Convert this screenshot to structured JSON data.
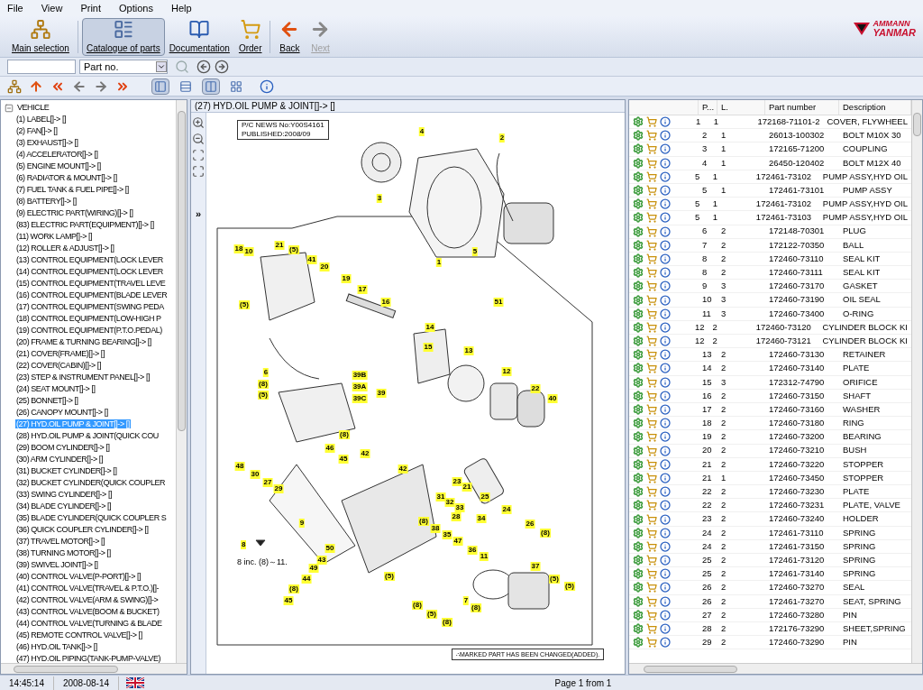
{
  "menu": [
    "File",
    "View",
    "Print",
    "Options",
    "Help"
  ],
  "toolbar": [
    {
      "kind": "main",
      "label": "Main selection",
      "selected": false,
      "disabled": false
    },
    {
      "kind": "catalogue",
      "label": "Catalogue of parts",
      "selected": true,
      "disabled": false
    },
    {
      "kind": "docs",
      "label": "Documentation",
      "selected": false,
      "disabled": false
    },
    {
      "kind": "order",
      "label": "Order",
      "selected": false,
      "disabled": false
    },
    {
      "kind": "back",
      "label": "Back",
      "selected": false,
      "disabled": false
    },
    {
      "kind": "next",
      "label": "Next",
      "selected": false,
      "disabled": true
    }
  ],
  "logo": {
    "line1": "AMMANN",
    "line2": "YANMAR"
  },
  "search": {
    "field": "Part no."
  },
  "view_buttons": [
    {
      "selected": true
    },
    {
      "selected": false
    },
    {
      "selected": true
    },
    {
      "selected": false
    }
  ],
  "tree": {
    "label": "VEHICLE",
    "expanded": true,
    "children": [
      {
        "label": "(1) LABEL[]-> []",
        "selected": false
      },
      {
        "label": "(2) FAN[]-> []",
        "selected": false
      },
      {
        "label": "(3) EXHAUST[]-> []",
        "selected": false
      },
      {
        "label": "(4) ACCELERATOR[]-> []",
        "selected": false
      },
      {
        "label": "(5) ENGINE MOUNT[]-> []",
        "selected": false
      },
      {
        "label": "(6) RADIATOR & MOUNT[]-> []",
        "selected": false
      },
      {
        "label": "(7) FUEL TANK & FUEL PIPE[]-> []",
        "selected": false
      },
      {
        "label": "(8) BATTERY[]-> []",
        "selected": false
      },
      {
        "label": "(9) ELECTRIC PART(WIRING)[]-> []",
        "selected": false
      },
      {
        "label": "(83) ELECTRIC PART(EQUIPMENT)[]-> []",
        "selected": false
      },
      {
        "label": "(11) WORK LAMP[]-> []",
        "selected": false
      },
      {
        "label": "(12) ROLLER & ADJUST[]-> []",
        "selected": false
      },
      {
        "label": "(13) CONTROL EQUIPMENT(LOCK LEVER",
        "selected": false
      },
      {
        "label": "(14) CONTROL EQUIPMENT(LOCK LEVER",
        "selected": false
      },
      {
        "label": "(15) CONTROL EQUIPMENT(TRAVEL LEVE",
        "selected": false
      },
      {
        "label": "(16) CONTROL EQUIPMENT(BLADE LEVER",
        "selected": false
      },
      {
        "label": "(17) CONTROL EQUIPMENT(SWING PEDA",
        "selected": false
      },
      {
        "label": "(18) CONTROL EQUIPMENT(LOW-HIGH P",
        "selected": false
      },
      {
        "label": "(19) CONTROL EQUIPMENT(P.T.O.PEDAL)",
        "selected": false
      },
      {
        "label": "(20) FRAME & TURNING BEARING[]-> []",
        "selected": false
      },
      {
        "label": "(21) COVER(FRAME)[]-> []",
        "selected": false
      },
      {
        "label": "(22) COVER(CABIN)[]-> []",
        "selected": false
      },
      {
        "label": "(23) STEP & INSTRUMENT PANEL[]-> []",
        "selected": false
      },
      {
        "label": "(24) SEAT MOUNT[]-> []",
        "selected": false
      },
      {
        "label": "(25) BONNET[]-> []",
        "selected": false
      },
      {
        "label": "(26) CANOPY MOUNT[]-> []",
        "selected": false
      },
      {
        "label": "(27) HYD.OIL PUMP & JOINT[]-> []",
        "selected": true
      },
      {
        "label": "(28) HYD.OIL PUMP & JOINT(QUICK COU",
        "selected": false
      },
      {
        "label": "(29) BOOM CYLINDER[]-> []",
        "selected": false
      },
      {
        "label": "(30) ARM CYLINDER[]-> []",
        "selected": false
      },
      {
        "label": "(31) BUCKET CYLINDER[]-> []",
        "selected": false
      },
      {
        "label": "(32) BUCKET CYLINDER(QUICK COUPLER",
        "selected": false
      },
      {
        "label": "(33) SWING CYLINDER[]-> []",
        "selected": false
      },
      {
        "label": "(34) BLADE CYLINDER[]-> []",
        "selected": false
      },
      {
        "label": "(35) BLADE CYLINDER(QUICK COUPLER S",
        "selected": false
      },
      {
        "label": "(36) QUICK COUPLER CYLINDER[]-> []",
        "selected": false
      },
      {
        "label": "(37) TRAVEL MOTOR[]-> []",
        "selected": false
      },
      {
        "label": "(38) TURNING MOTOR[]-> []",
        "selected": false
      },
      {
        "label": "(39) SWIVEL JOINT[]-> []",
        "selected": false
      },
      {
        "label": "(40) CONTROL VALVE(P-PORT)[]-> []",
        "selected": false
      },
      {
        "label": "(41) CONTROL VALVE(TRAVEL & P.T.O.)[]-",
        "selected": false
      },
      {
        "label": "(42) CONTROL VALVE(ARM & SWING)[]->",
        "selected": false
      },
      {
        "label": "(43) CONTROL VALVE(BOOM & BUCKET)",
        "selected": false
      },
      {
        "label": "(44) CONTROL VALVE(TURNING & BLADE",
        "selected": false
      },
      {
        "label": "(45) REMOTE CONTROL VALVE[]-> []",
        "selected": false
      },
      {
        "label": "(46) HYD.OIL TANK[]-> []",
        "selected": false
      },
      {
        "label": "(47) HYD.OIL PIPING(TANK-PUMP-VALVE)",
        "selected": false
      }
    ]
  },
  "drawing": {
    "title": "(27) HYD.OIL PUMP & JOINT[]-> []",
    "panel_toggle": "»",
    "stamp": [
      "P/C NEWS No:Y00S4161",
      "PUBLISHED:2008/09"
    ],
    "note": "8 inc. (8)～11.",
    "note_mark": "8",
    "footer": "∴MARKED PART HAS BEEN CHANGED(ADDED).",
    "callouts": [
      "4",
      "2",
      "3",
      "1",
      "5",
      "51",
      "18",
      "10",
      "21",
      "(5)",
      "41",
      "20",
      "19",
      "17",
      "16",
      "(5)",
      "14",
      "15",
      "13",
      "12",
      "22",
      "40",
      "6",
      "(8)",
      "(5)",
      "39B",
      "39A",
      "39",
      "39C",
      "(8)",
      "46",
      "45",
      "42",
      "42",
      "48",
      "30",
      "27",
      "29",
      "23",
      "25",
      "21",
      "9",
      "31",
      "32",
      "33",
      "34",
      "28",
      "24",
      "26",
      "(8)",
      "(8)",
      "38",
      "35",
      "47",
      "36",
      "11",
      "50",
      "43",
      "49",
      "44",
      "(8)",
      "45",
      "37",
      "(5)",
      "7",
      "(8)",
      "(5)",
      "(5)",
      "(8)",
      "(5)",
      "(8)"
    ]
  },
  "table": {
    "columns": [
      "P...",
      "L.",
      "Part number",
      "Description"
    ],
    "rows": [
      [
        "1",
        "1",
        "172168-71101-2",
        "COVER, FLYWHEEL"
      ],
      [
        "2",
        "1",
        "26013-100302",
        "BOLT M10X 30"
      ],
      [
        "3",
        "1",
        "172165-71200",
        "COUPLING"
      ],
      [
        "4",
        "1",
        "26450-120402",
        "BOLT M12X 40"
      ],
      [
        "5",
        "1",
        "172461-73102",
        "PUMP ASSY,HYD OIL"
      ],
      [
        "5",
        "1",
        "172461-73101",
        "PUMP ASSY"
      ],
      [
        "5",
        "1",
        "172461-73102",
        "PUMP ASSY,HYD OIL"
      ],
      [
        "5",
        "1",
        "172461-73103",
        "PUMP ASSY,HYD OIL"
      ],
      [
        "6",
        "2",
        "172148-70301",
        "PLUG"
      ],
      [
        "7",
        "2",
        "172122-70350",
        "BALL"
      ],
      [
        "8",
        "2",
        "172460-73110",
        "SEAL KIT"
      ],
      [
        "8",
        "2",
        "172460-73111",
        "SEAL KIT"
      ],
      [
        "9",
        "3",
        "172460-73170",
        "GASKET"
      ],
      [
        "10",
        "3",
        "172460-73190",
        "OIL SEAL"
      ],
      [
        "11",
        "3",
        "172460-73400",
        "O-RING"
      ],
      [
        "12",
        "2",
        "172460-73120",
        "CYLINDER BLOCK KI"
      ],
      [
        "12",
        "2",
        "172460-73121",
        "CYLINDER BLOCK KI"
      ],
      [
        "13",
        "2",
        "172460-73130",
        "RETAINER"
      ],
      [
        "14",
        "2",
        "172460-73140",
        "PLATE"
      ],
      [
        "15",
        "3",
        "172312-74790",
        "ORIFICE"
      ],
      [
        "16",
        "2",
        "172460-73150",
        "SHAFT"
      ],
      [
        "17",
        "2",
        "172460-73160",
        "WASHER"
      ],
      [
        "18",
        "2",
        "172460-73180",
        "RING"
      ],
      [
        "19",
        "2",
        "172460-73200",
        "BEARING"
      ],
      [
        "20",
        "2",
        "172460-73210",
        "BUSH"
      ],
      [
        "21",
        "2",
        "172460-73220",
        "STOPPER"
      ],
      [
        "21",
        "1",
        "172460-73450",
        "STOPPER"
      ],
      [
        "22",
        "2",
        "172460-73230",
        "PLATE"
      ],
      [
        "22",
        "2",
        "172460-73231",
        "PLATE, VALVE"
      ],
      [
        "23",
        "2",
        "172460-73240",
        "HOLDER"
      ],
      [
        "24",
        "2",
        "172461-73110",
        "SPRING"
      ],
      [
        "24",
        "2",
        "172461-73150",
        "SPRING"
      ],
      [
        "25",
        "2",
        "172461-73120",
        "SPRING"
      ],
      [
        "25",
        "2",
        "172461-73140",
        "SPRING"
      ],
      [
        "26",
        "2",
        "172460-73270",
        "SEAL"
      ],
      [
        "26",
        "2",
        "172461-73270",
        "SEAT, SPRING"
      ],
      [
        "27",
        "2",
        "172460-73280",
        "PIN"
      ],
      [
        "28",
        "2",
        "172176-73290",
        "SHEET,SPRING"
      ],
      [
        "29",
        "2",
        "172460-73290",
        "PIN"
      ]
    ]
  },
  "status": {
    "time": "14:45:14",
    "date": "2008-08-14",
    "page": "Page 1 from 1"
  }
}
